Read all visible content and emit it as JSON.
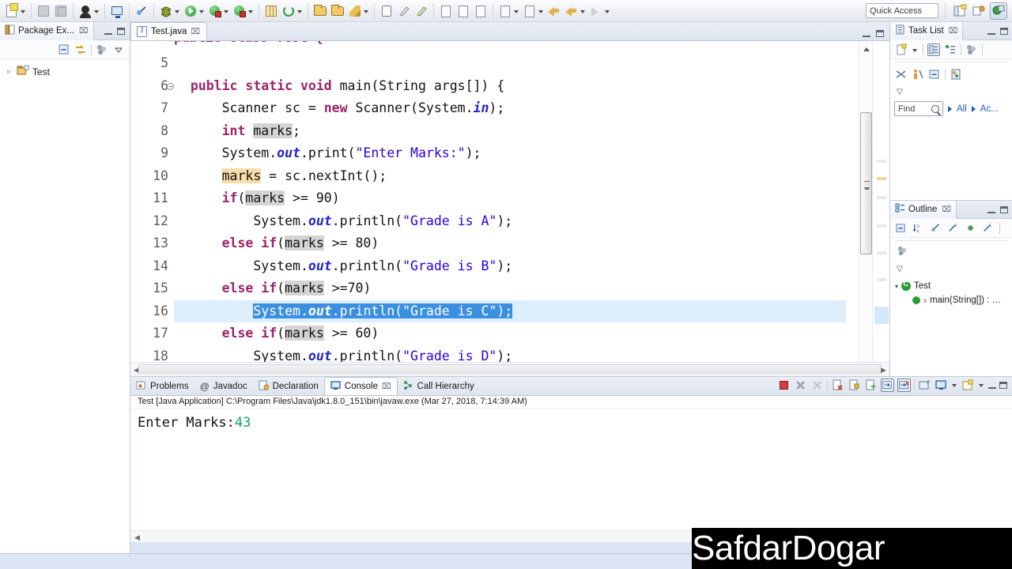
{
  "toolbar": {
    "items": [
      {
        "name": "new-file",
        "icon": "new-file-icon",
        "dropdown": true
      },
      {
        "name": "save",
        "icon": "save-icon",
        "dropdown": false
      },
      {
        "name": "save-all",
        "icon": "save-all-icon",
        "dropdown": false
      },
      {
        "name": "person",
        "icon": "person-icon",
        "dropdown": true
      },
      {
        "name": "open-console",
        "icon": "monitor-icon",
        "dropdown": false
      },
      {
        "name": "skip-breakpoints",
        "icon": "skip-breakpoints-icon",
        "dropdown": false
      },
      {
        "name": "debug",
        "icon": "bug-icon",
        "dropdown": true
      },
      {
        "name": "run",
        "icon": "run-play-icon",
        "dropdown": true
      },
      {
        "name": "run-external",
        "icon": "run-external-icon",
        "dropdown": true
      },
      {
        "name": "run-coverage",
        "icon": "coverage-icon",
        "dropdown": true
      },
      {
        "name": "new-java-package",
        "icon": "package-icon",
        "dropdown": false
      },
      {
        "name": "refresh",
        "icon": "refresh-icon",
        "dropdown": true
      },
      {
        "name": "open-type",
        "icon": "open-type-icon",
        "dropdown": false
      },
      {
        "name": "open-task",
        "icon": "open-task-icon",
        "dropdown": false
      },
      {
        "name": "search",
        "icon": "search-pencil-icon",
        "dropdown": true
      },
      {
        "name": "previous-annotation",
        "icon": "pin-icon",
        "dropdown": false
      },
      {
        "name": "next-annotation",
        "icon": "marker-icon",
        "dropdown": false
      },
      {
        "name": "toggle-mark",
        "icon": "mark-occurrences-icon",
        "dropdown": false
      },
      {
        "name": "last-edit",
        "icon": "last-edit-icon",
        "dropdown": false
      },
      {
        "name": "show-whitespace",
        "icon": "whitespace-icon",
        "dropdown": false
      },
      {
        "name": "show-pilcrow",
        "icon": "pilcrow-icon",
        "dropdown": false
      },
      {
        "name": "next-member",
        "icon": "next-member-icon",
        "dropdown": true
      },
      {
        "name": "prev-member",
        "icon": "prev-member-icon",
        "dropdown": true
      },
      {
        "name": "back",
        "icon": "back-arrow-icon",
        "dropdown": false
      },
      {
        "name": "forward",
        "icon": "forward-arrow-icon",
        "dropdown": true
      },
      {
        "name": "next-nav",
        "icon": "next-nav-arrow-icon",
        "dropdown": true
      }
    ],
    "quick_access_placeholder": "Quick Access",
    "open-perspective-icon": "open-perspective-icon",
    "perspective-java-icon": "perspective-java-icon",
    "perspective-debug-icon": "perspective-debug-icon"
  },
  "package_explorer": {
    "tab_label": "Package Ex...",
    "close_glyph": "⌧",
    "toolbar_icons": [
      "collapse-all-icon",
      "link-with-editor-icon",
      "view-menu-filter-icon",
      "view-menu-icon"
    ],
    "tree": [
      {
        "label": "Test",
        "expander": "▹",
        "icon": "java-project-icon"
      }
    ]
  },
  "editor": {
    "tab_label": "Test.java",
    "close_glyph": "⌧",
    "file_icon": "java-file-icon",
    "partial_top_line": "public class Test {",
    "first_visible_line": 5,
    "selected_line": 16,
    "fold_marker_line": 6,
    "lines": [
      {
        "num": 5,
        "tokens": [
          {
            "t": "",
            "c": "plain"
          }
        ]
      },
      {
        "num": 6,
        "tokens": [
          {
            "t": "  ",
            "c": "plain"
          },
          {
            "t": "public static void ",
            "c": "kw"
          },
          {
            "t": "main(String args[]) {",
            "c": "plain"
          }
        ]
      },
      {
        "num": 7,
        "tokens": [
          {
            "t": "      Scanner sc = ",
            "c": "plain"
          },
          {
            "t": "new ",
            "c": "kw"
          },
          {
            "t": "Scanner(System.",
            "c": "plain"
          },
          {
            "t": "in",
            "c": "fld"
          },
          {
            "t": ");",
            "c": "plain"
          }
        ]
      },
      {
        "num": 8,
        "tokens": [
          {
            "t": "      ",
            "c": "plain"
          },
          {
            "t": "int ",
            "c": "kw"
          },
          {
            "t": "marks",
            "c": "occ-read"
          },
          {
            "t": ";",
            "c": "plain"
          }
        ]
      },
      {
        "num": 9,
        "tokens": [
          {
            "t": "      System.",
            "c": "plain"
          },
          {
            "t": "out",
            "c": "fld"
          },
          {
            "t": ".print(",
            "c": "plain"
          },
          {
            "t": "\"Enter Marks:\"",
            "c": "st"
          },
          {
            "t": ");",
            "c": "plain"
          }
        ]
      },
      {
        "num": 10,
        "tokens": [
          {
            "t": "      ",
            "c": "plain"
          },
          {
            "t": "marks",
            "c": "occ-write"
          },
          {
            "t": " = sc.nextInt();",
            "c": "plain"
          }
        ]
      },
      {
        "num": 11,
        "tokens": [
          {
            "t": "      ",
            "c": "plain"
          },
          {
            "t": "if",
            "c": "kw"
          },
          {
            "t": "(",
            "c": "plain"
          },
          {
            "t": "marks",
            "c": "occ-read"
          },
          {
            "t": " >= 90)",
            "c": "plain"
          }
        ]
      },
      {
        "num": 12,
        "tokens": [
          {
            "t": "          System.",
            "c": "plain"
          },
          {
            "t": "out",
            "c": "fld"
          },
          {
            "t": ".println(",
            "c": "plain"
          },
          {
            "t": "\"Grade is A\"",
            "c": "st"
          },
          {
            "t": ");",
            "c": "plain"
          }
        ]
      },
      {
        "num": 13,
        "tokens": [
          {
            "t": "      ",
            "c": "plain"
          },
          {
            "t": "else if",
            "c": "kw"
          },
          {
            "t": "(",
            "c": "plain"
          },
          {
            "t": "marks",
            "c": "occ-read"
          },
          {
            "t": " >= 80)",
            "c": "plain"
          }
        ]
      },
      {
        "num": 14,
        "tokens": [
          {
            "t": "          System.",
            "c": "plain"
          },
          {
            "t": "out",
            "c": "fld"
          },
          {
            "t": ".println(",
            "c": "plain"
          },
          {
            "t": "\"Grade is B\"",
            "c": "st"
          },
          {
            "t": ");",
            "c": "plain"
          }
        ]
      },
      {
        "num": 15,
        "tokens": [
          {
            "t": "      ",
            "c": "plain"
          },
          {
            "t": "else if",
            "c": "kw"
          },
          {
            "t": "(",
            "c": "plain"
          },
          {
            "t": "marks",
            "c": "occ-read"
          },
          {
            "t": " >=70)",
            "c": "plain"
          }
        ]
      },
      {
        "num": 16,
        "tokens": [
          {
            "t": "          ",
            "c": "plain"
          },
          {
            "t": "System.",
            "c": "selhl"
          },
          {
            "t": "out",
            "c": "selhl-fld"
          },
          {
            "t": ".println(\"Grade is C\");",
            "c": "selhl"
          }
        ]
      },
      {
        "num": 17,
        "tokens": [
          {
            "t": "      ",
            "c": "plain"
          },
          {
            "t": "else if",
            "c": "kw"
          },
          {
            "t": "(",
            "c": "plain"
          },
          {
            "t": "marks",
            "c": "occ-read"
          },
          {
            "t": " >= 60)",
            "c": "plain"
          }
        ]
      },
      {
        "num": 18,
        "tokens": [
          {
            "t": "          System.",
            "c": "plain"
          },
          {
            "t": "out",
            "c": "fld"
          },
          {
            "t": ".println(",
            "c": "plain"
          },
          {
            "t": "\"Grade is D\"",
            "c": "st"
          },
          {
            "t": ");",
            "c": "plain"
          }
        ]
      }
    ],
    "colors": {
      "keyword": "#9c2468",
      "string": "#2a00e0",
      "field": "#2222cc",
      "occurrence_read_bg": "#d4d4d4",
      "occurrence_write_bg": "#f7dda8",
      "selection_bg": "#3b8fe0",
      "selection_line_bg": "#ddeeff",
      "changebar": "#80c0e6"
    }
  },
  "task_list": {
    "tab_label": "Task List",
    "close_glyph": "⌧",
    "toolbar_icons": [
      "new-task-icon",
      "categorized-view-icon",
      "scheduled-view-icon",
      "focus-on-workweek-icon"
    ],
    "toolbar_icons_row2": [
      "synchronize-changed-icon",
      "show-only-my-tasks-icon",
      "collapse-all-icon",
      "restore-tasks-icon"
    ],
    "view_menu_glyph": "▽",
    "find_placeholder": "Find",
    "search_icon": "magnifier-icon",
    "filter_all": "All",
    "filter_activate": "Ac..."
  },
  "outline": {
    "tab_label": "Outline",
    "close_glyph": "⌧",
    "toolbar_icons": [
      "collapse-all-icon",
      "sort-alphabetically-icon",
      "hide-fields-icon",
      "hide-static-icon",
      "hide-non-public-icon",
      "hide-local-types-icon"
    ],
    "view_menu_glyph": "▽",
    "tree": [
      {
        "label": "Test",
        "expander": "▾",
        "icon": "java-class-icon",
        "depth": 0
      },
      {
        "label": "main(String[]) : …",
        "expander": "",
        "icon": "java-method-icon",
        "depth": 1
      }
    ]
  },
  "console": {
    "tabs": [
      {
        "label": "Problems",
        "icon": "problems-icon",
        "active": false
      },
      {
        "label": "Javadoc",
        "icon": "javadoc-icon",
        "active": false
      },
      {
        "label": "Declaration",
        "icon": "declaration-icon",
        "active": false
      },
      {
        "label": "Console",
        "icon": "console-icon",
        "active": true,
        "close_glyph": "⌧"
      },
      {
        "label": "Call Hierarchy",
        "icon": "call-hierarchy-icon",
        "active": false
      }
    ],
    "toolbar_icons": [
      "terminate-icon",
      "remove-launch-icon",
      "remove-all-terminated-icon",
      "clear-console-icon",
      "scroll-lock-icon",
      "word-wrap-icon",
      "show-console-on-stdout-icon",
      "show-console-on-stderr-icon",
      "pin-console-icon",
      "display-selected-console-icon",
      "open-console-icon"
    ],
    "header": "Test [Java Application] C:\\Program Files\\Java\\jdk1.8.0_151\\bin\\javaw.exe (Mar 27, 2018, 7:14:39 AM)",
    "output_prompt": "Enter Marks:",
    "output_input": "43",
    "input_color": "#16a35a"
  },
  "watermark": {
    "text": "SafdarDogar"
  }
}
